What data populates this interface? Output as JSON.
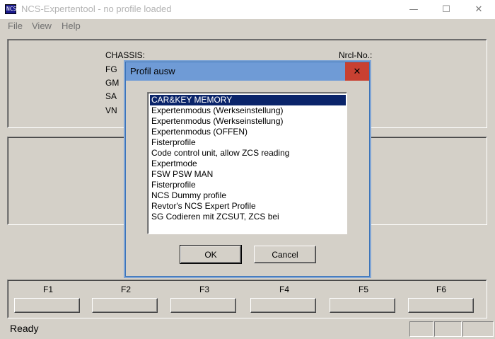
{
  "window": {
    "title": "NCS-Expertentool - no profile loaded",
    "icon_label": "NCS",
    "minimize_glyph": "—",
    "maximize_glyph": "☐",
    "close_glyph": "✕"
  },
  "menu": {
    "file": "File",
    "view": "View",
    "help": "Help"
  },
  "vehicle_info": {
    "chassis": "CHASSIS:",
    "fg": "FG",
    "gm": "GM",
    "sa": "SA",
    "vn": "VN",
    "nrcl": "Nrcl-No.:"
  },
  "fkeys": [
    "F1",
    "F2",
    "F3",
    "F4",
    "F5",
    "F6"
  ],
  "status": {
    "text": "Ready"
  },
  "dialog": {
    "title": "Profil ausw",
    "close_glyph": "✕",
    "profiles": [
      "CAR&KEY MEMORY",
      "Expertenmodus (Werkseinstellung)",
      "Expertenmodus (Werkseinstellung)",
      "Expertenmodus (OFFEN)",
      "Fisterprofile",
      "Code control unit, allow ZCS reading",
      "Expertmode",
      "FSW PSW MAN",
      "Fisterprofile",
      "NCS Dummy profile",
      "Revtor's NCS Expert Profile",
      "SG Codieren mit ZCSUT, ZCS bei"
    ],
    "selected_index": 0,
    "ok_label": "OK",
    "cancel_label": "Cancel"
  },
  "colors": {
    "face": "#d4d0c8",
    "dialog_title": "#6f9bd6",
    "dialog_close": "#c84031",
    "selection": "#0a246a"
  }
}
